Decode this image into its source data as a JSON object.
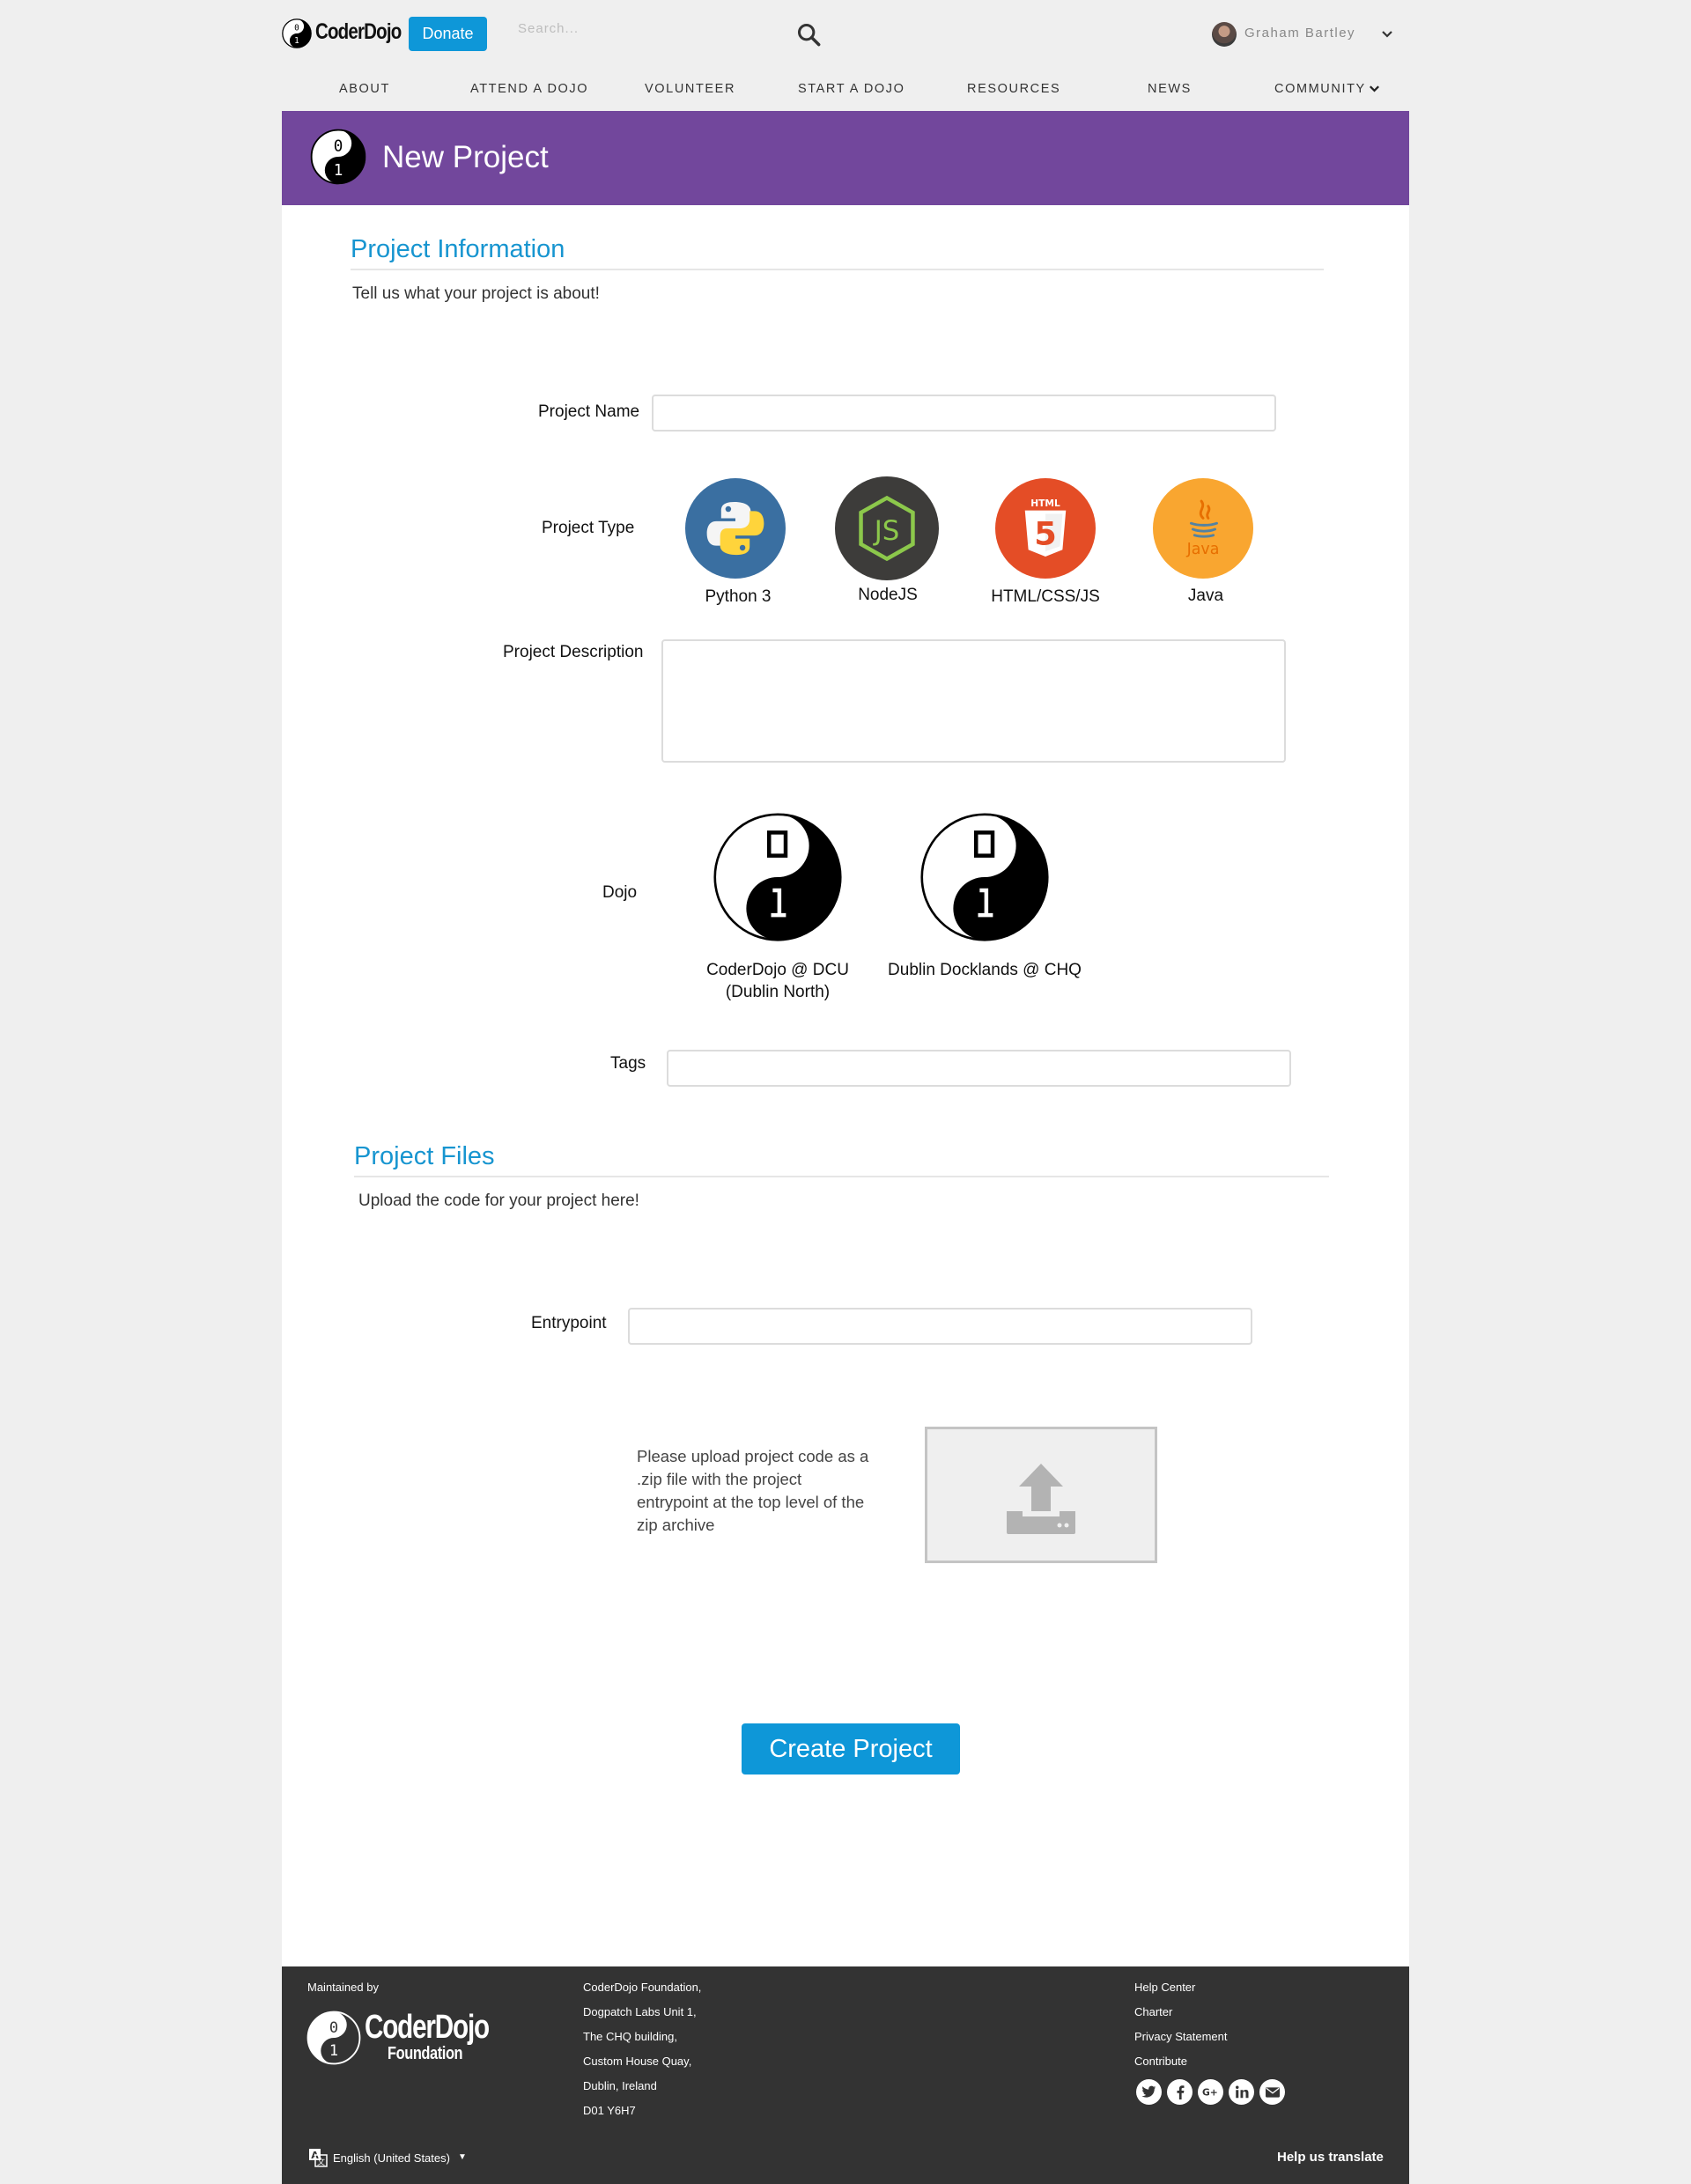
{
  "header": {
    "brand": "CoderDojo",
    "donate_label": "Donate",
    "search_placeholder": "Search...",
    "user_name": "Graham Bartley"
  },
  "nav": {
    "items": [
      "ABOUT",
      "ATTEND A DOJO",
      "VOLUNTEER",
      "START A DOJO",
      "RESOURCES",
      "NEWS",
      "COMMUNITY"
    ]
  },
  "banner": {
    "title": "New Project"
  },
  "project_info": {
    "title": "Project Information",
    "subtitle": "Tell us what your project is about!",
    "name_label": "Project Name",
    "name_value": "",
    "type_label": "Project Type",
    "types": [
      {
        "label": "Python 3",
        "icon": "python-icon",
        "color": "#3a6fa1"
      },
      {
        "label": "NodeJS",
        "icon": "nodejs-icon",
        "color": "#3d3c3a"
      },
      {
        "label": "HTML/CSS/JS",
        "icon": "html5-icon",
        "color": "#e44d26"
      },
      {
        "label": "Java",
        "icon": "java-icon",
        "color": "#f9a630"
      }
    ],
    "description_label": "Project Description",
    "description_value": "",
    "dojo_label": "Dojo",
    "dojos": [
      {
        "line1": "CoderDojo @ DCU",
        "line2": "(Dublin North)"
      },
      {
        "line1": "Dublin Docklands @ CHQ",
        "line2": ""
      }
    ],
    "tags_label": "Tags",
    "tags_value": ""
  },
  "project_files": {
    "title": "Project Files",
    "subtitle": "Upload the code for your project here!",
    "entrypoint_label": "Entrypoint",
    "entrypoint_value": "",
    "upload_help": "Please upload project code as a .zip file with the project entrypoint at the top level of the zip archive"
  },
  "create_label": "Create Project",
  "footer": {
    "maintained_by": "Maintained by",
    "foundation_brand_line1": "CoderDojo",
    "foundation_brand_line2": "Foundation",
    "address": [
      "CoderDojo Foundation,",
      "Dogpatch Labs Unit 1,",
      "The CHQ building,",
      "Custom House Quay,",
      "Dublin, Ireland",
      "D01 Y6H7"
    ],
    "links": [
      "Help Center",
      "Charter",
      "Privacy Statement",
      "Contribute"
    ],
    "language": "English (United States)",
    "help_translate": "Help us translate",
    "socials": [
      "twitter-icon",
      "facebook-icon",
      "google-plus-icon",
      "linkedin-icon",
      "email-icon"
    ]
  },
  "colors": {
    "accent": "#0e97d8",
    "banner": "#72479c",
    "section_title": "#1795d0",
    "footer_bg": "#333333"
  }
}
